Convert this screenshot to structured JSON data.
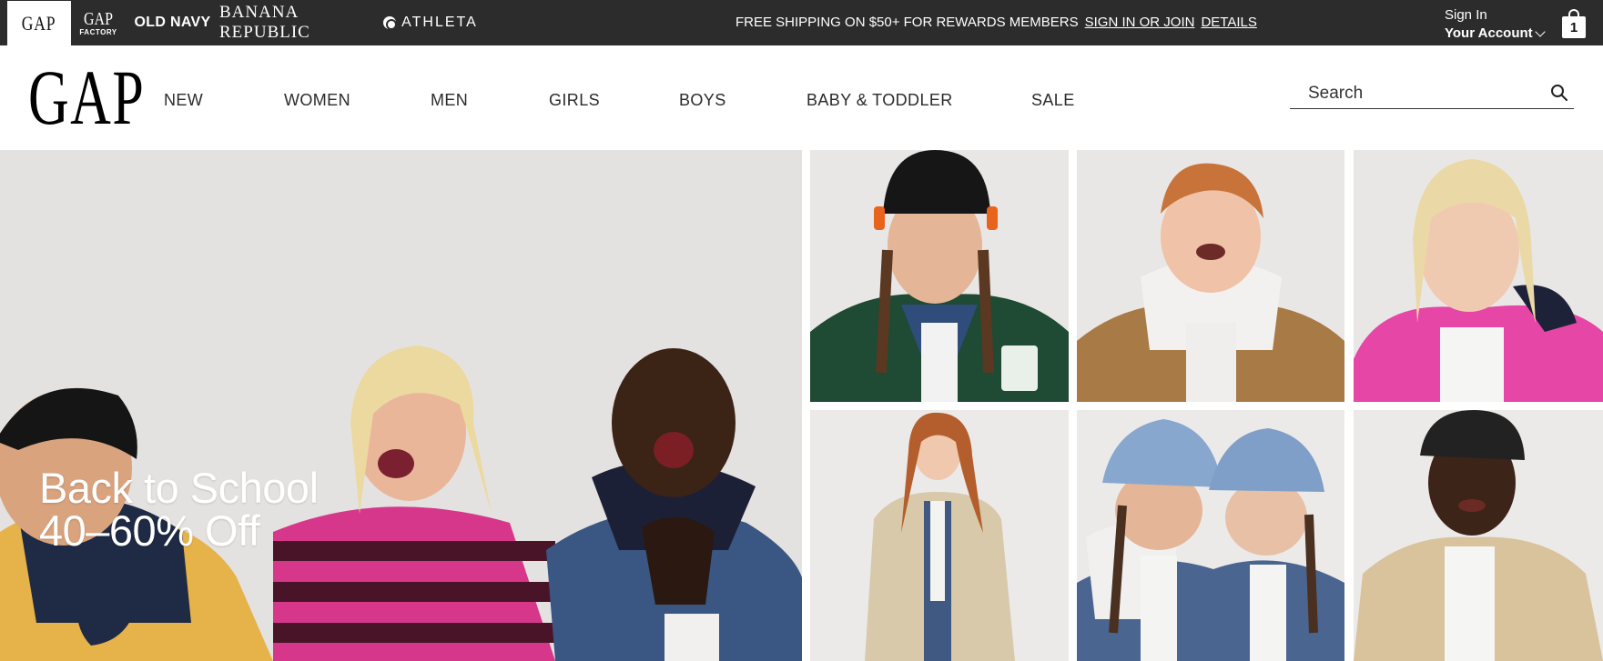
{
  "brands": {
    "gap": "GAP",
    "gap_factory_top": "GAP",
    "gap_factory_bottom": "FACTORY",
    "old_navy": "OLD NAVY",
    "banana_republic": "BANANA REPUBLIC",
    "athleta": "ATHLETA"
  },
  "promo": {
    "text": "FREE SHIPPING ON $50+ FOR REWARDS MEMBERS",
    "signin_link": "SIGN IN OR JOIN",
    "details_link": "DETAILS"
  },
  "account": {
    "line1": "Sign In",
    "line2": "Your Account"
  },
  "bag": {
    "count": "1"
  },
  "logo": "GAP",
  "nav": {
    "items": [
      "NEW",
      "WOMEN",
      "MEN",
      "GIRLS",
      "BOYS",
      "BABY & TODDLER",
      "SALE"
    ]
  },
  "search": {
    "placeholder": "Search"
  },
  "hero": {
    "line1": "Back to School",
    "line2": "40–60% Off"
  },
  "colors": {
    "topbar": "#2c2c2c",
    "white": "#ffffff",
    "nav_text": "#2b2b2b"
  }
}
